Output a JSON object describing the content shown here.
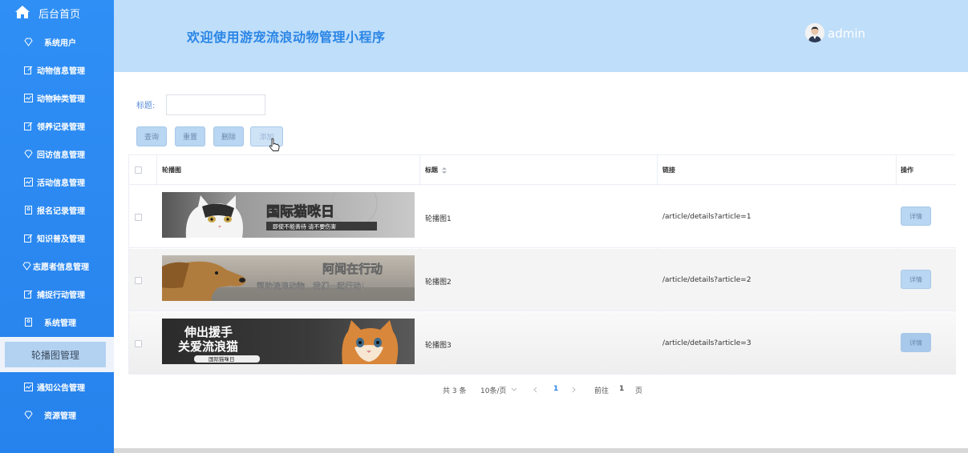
{
  "sidebar": {
    "home_label": "后台首页",
    "items": [
      {
        "label": "系统用户"
      },
      {
        "label": "动物信息管理"
      },
      {
        "label": "动物种类管理"
      },
      {
        "label": "领养记录管理"
      },
      {
        "label": "回访信息管理"
      },
      {
        "label": "活动信息管理"
      },
      {
        "label": "报名记录管理"
      },
      {
        "label": "知识普及管理"
      },
      {
        "label": "志愿者信息管理"
      },
      {
        "label": "捕捉行动管理"
      },
      {
        "label": "系统管理"
      }
    ],
    "active_label": "轮播图管理",
    "items_after": [
      {
        "label": "通知公告管理"
      },
      {
        "label": "资源管理"
      }
    ]
  },
  "header": {
    "title": "欢迎使用游宠流浪动物管理小程序",
    "username": "admin"
  },
  "filter": {
    "label": "标题:",
    "value": "",
    "placeholder": ""
  },
  "toolbar": {
    "query": "查询",
    "reset": "重置",
    "delete": "删除",
    "add": "添加"
  },
  "table": {
    "columns": [
      "轮播图",
      "标题",
      "链接",
      "操作"
    ],
    "rows": [
      {
        "title": "轮播图1",
        "link": "/article/details?article=1",
        "banner_main": "国际猫咪日",
        "banner_sub": "即使不能善待 请不要伤害",
        "action": "详情"
      },
      {
        "title": "轮播图2",
        "link": "/article/details?article=2",
        "banner_main": "阿闻在行动",
        "banner_sub": "帮助流浪动物，我们一起行动！",
        "action": "详情"
      },
      {
        "title": "轮播图3",
        "link": "/article/details?article=3",
        "banner_main": "伸出援手",
        "banner_main2": "关爱流浪猫",
        "banner_sub": "国际猫咪日",
        "action": "详情"
      }
    ]
  },
  "pagination": {
    "total": "共 3 条",
    "page_size": "10条/页",
    "current": "1",
    "goto_prefix": "前往",
    "goto_value": "1",
    "goto_suffix": "页"
  },
  "colors": {
    "sidebar": "#2f8ff5",
    "header": "#bfdef9",
    "title": "#2a85e6",
    "button": "#b9d6f2"
  }
}
